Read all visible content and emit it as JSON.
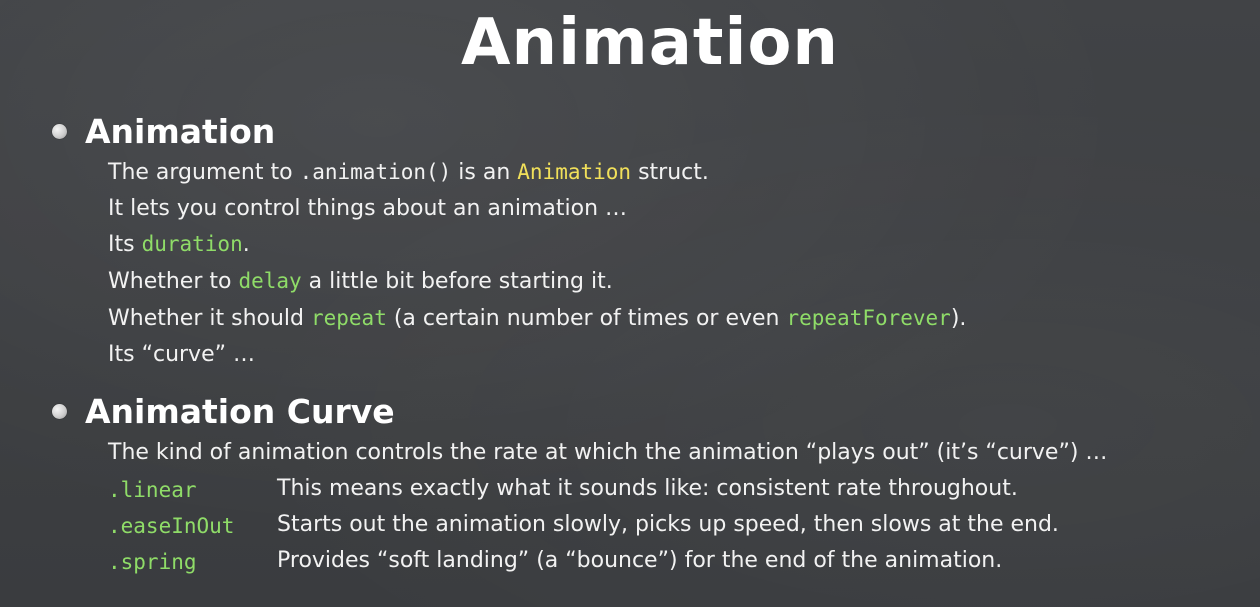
{
  "slide": {
    "title": "Animation",
    "sections": [
      {
        "heading": "Animation",
        "lines": [
          {
            "p1": "The argument to ",
            "code": ".animation()",
            "p2": " is an ",
            "highlight": "Animation",
            "p3": " struct."
          },
          {
            "text": "It lets you control things about an animation …"
          },
          {
            "p1": "Its ",
            "code": "duration",
            "p2": "."
          },
          {
            "p1": "Whether to ",
            "code": "delay",
            "p2": " a little bit before starting it."
          },
          {
            "p1": "Whether it should ",
            "code": "repeat",
            "p2": " (a certain number of times or even ",
            "code2": "repeatForever",
            "p3": ")."
          },
          {
            "text": "Its “curve” …"
          }
        ]
      },
      {
        "heading": "Animation Curve",
        "intro": "The kind of animation controls the rate at which the animation “plays out” (it’s “curve”) …",
        "curves": [
          {
            "name": ".linear",
            "desc": "This means exactly what it sounds like: consistent rate throughout."
          },
          {
            "name": ".easeInOut",
            "desc": "Starts out the animation slowly, picks up speed, then slows at the end."
          },
          {
            "name": ".spring",
            "desc": "Provides “soft landing” (a “bounce”) for the end of the animation."
          }
        ]
      }
    ]
  },
  "colors": {
    "background": "#3d3f42",
    "text": "#f2f2f2",
    "keyword_yellow": "#f1e05a",
    "keyword_green": "#8fdc68"
  }
}
